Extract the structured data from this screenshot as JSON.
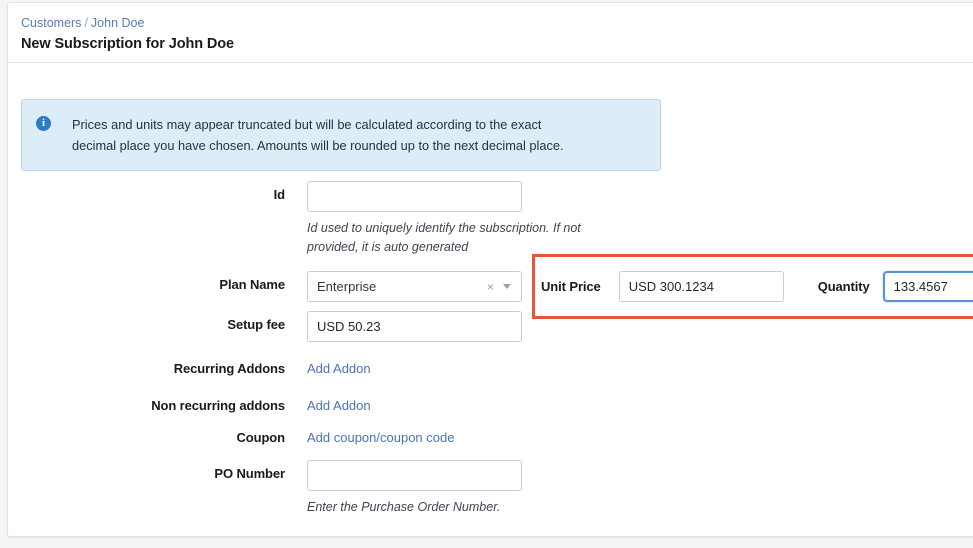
{
  "header": {
    "breadcrumb": {
      "root": "Customers",
      "separator": "/",
      "current": "John Doe"
    },
    "title": "New Subscription for John Doe"
  },
  "info_banner": {
    "icon": "info-circle-icon",
    "line1": "Prices and units may appear truncated but will be calculated according to the exact",
    "line2": "decimal place you have chosen. Amounts will be rounded up to the next decimal place."
  },
  "form": {
    "id": {
      "label": "Id",
      "value": "",
      "helper": "Id used to uniquely identify the subscription. If not provided, it is auto generated"
    },
    "plan_name": {
      "label": "Plan Name",
      "value": "Enterprise",
      "clear_icon": "×"
    },
    "setup_fee": {
      "label": "Setup fee",
      "value": "USD  50.23"
    },
    "recurring_addons": {
      "label": "Recurring Addons",
      "link": "Add Addon"
    },
    "non_recurring_addons": {
      "label": "Non recurring addons",
      "link": "Add Addon"
    },
    "coupon": {
      "label": "Coupon",
      "link": "Add coupon/coupon code"
    },
    "po_number": {
      "label": "PO Number",
      "value": "",
      "helper": "Enter the Purchase Order Number."
    }
  },
  "price_group": {
    "unit_price": {
      "label": "Unit Price",
      "value": "USD  300.1234"
    },
    "quantity": {
      "label": "Quantity",
      "value": "133.4567"
    },
    "highlight_color": "#e4573d",
    "focus_color": "#5b93d6"
  }
}
